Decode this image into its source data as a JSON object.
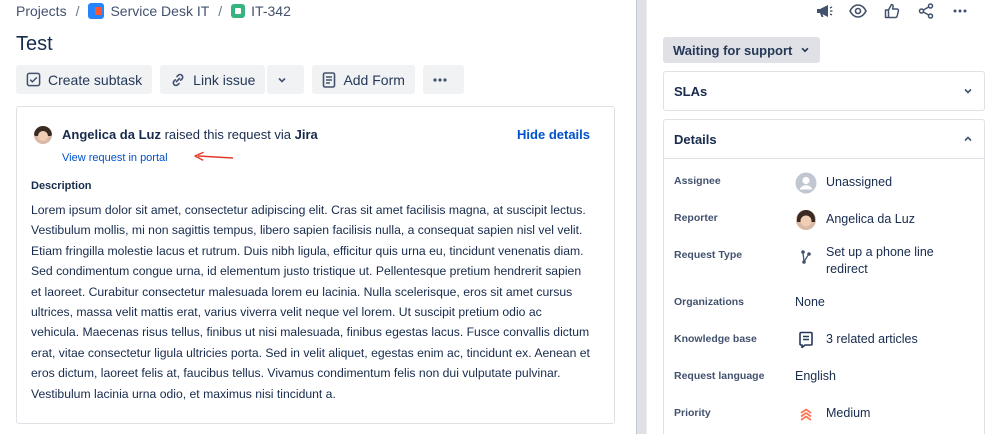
{
  "breadcrumb": {
    "projects": "Projects",
    "sep": "/",
    "project": "Service Desk IT",
    "issue_key": "IT-342"
  },
  "issue": {
    "title": "Test"
  },
  "toolbar": {
    "create_subtask": "Create subtask",
    "link_issue": "Link issue",
    "add_form": "Add Form"
  },
  "request": {
    "reporter": "Angelica da Luz",
    "raised_text": " raised this request via ",
    "channel": "Jira",
    "hide_details": "Hide details",
    "portal_link": "View request in portal",
    "description_label": "Description",
    "description": "Lorem ipsum dolor sit amet, consectetur adipiscing elit. Cras sit amet facilisis magna, at suscipit lectus. Vestibulum mollis, mi non sagittis tempus, libero sapien facilisis nulla, a consequat sapien nisl vel velit. Etiam fringilla molestie lacus et rutrum. Duis nibh ligula, efficitur quis urna eu, tincidunt venenatis diam. Sed condimentum congue urna, id elementum justo tristique ut. Pellentesque pretium hendrerit sapien et laoreet. Curabitur consectetur malesuada lorem eu lacinia. Nulla scelerisque, eros sit amet cursus ultrices, massa velit mattis erat, varius viverra velit neque vel lorem. Ut suscipit pretium odio ac vehicula. Maecenas risus tellus, finibus ut nisi malesuada, finibus egestas lacus. Fusce convallis dictum erat, vitae consectetur ligula ultricies porta. Sed in velit aliquet, egestas enim ac, tincidunt ex. Aenean et eros dictum, laoreet felis at, faucibus tellus. Vivamus condimentum felis non dui vulputate pulvinar. Vestibulum lacinia urna odio, et maximus nisi tincidunt a."
  },
  "sidebar": {
    "status": "Waiting for support",
    "sla_title": "SLAs",
    "details_title": "Details",
    "fields": [
      {
        "label": "Assignee",
        "value": "Unassigned"
      },
      {
        "label": "Reporter",
        "value": "Angelica da Luz"
      },
      {
        "label": "Request Type",
        "value": "Set up a phone line redirect"
      },
      {
        "label": "Organizations",
        "value": "None"
      },
      {
        "label": "Knowledge base",
        "value": "3 related articles"
      },
      {
        "label": "Request language",
        "value": "English"
      },
      {
        "label": "Priority",
        "value": "Medium"
      }
    ]
  },
  "colors": {
    "link": "#0052cc",
    "text": "#172b4d",
    "button_bg": "#f1f2f4",
    "status_bg": "#dfe1e6",
    "annotation_arrow": "#e03b2a",
    "priority_medium": "#ff7452"
  }
}
